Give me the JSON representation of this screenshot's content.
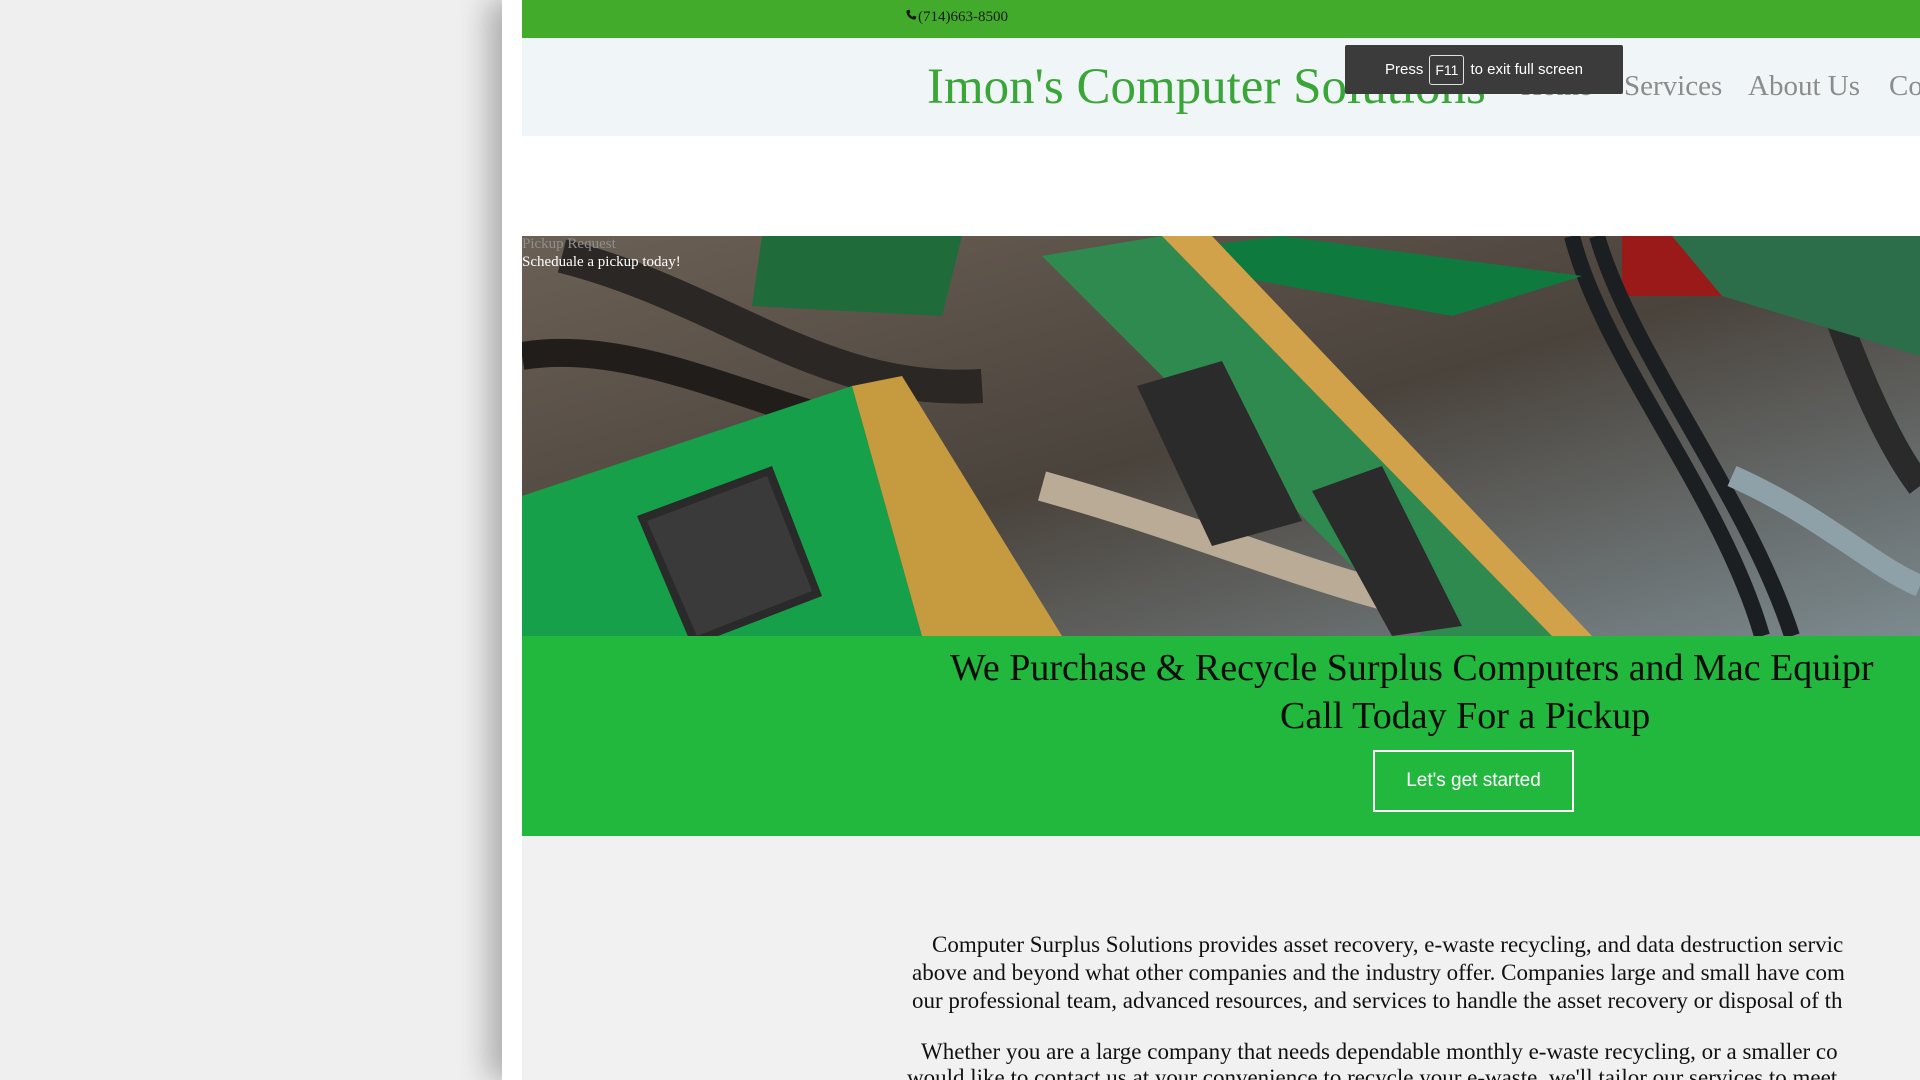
{
  "topbar": {
    "phone_icon": "phone-icon",
    "phone": "(714)663-8500",
    "accent": "#43ab2b"
  },
  "header": {
    "brand": "Imon's Computer Solutions",
    "nav": [
      {
        "label": "Home"
      },
      {
        "label": "Services"
      },
      {
        "label": "About Us"
      },
      {
        "label": "Co"
      }
    ]
  },
  "fullscreen_toast": {
    "press": "Press",
    "key": "F11",
    "rest": "to exit full screen"
  },
  "hero": {
    "kicker": "Pickup Request",
    "subtitle": "Scheduale a pickup today!"
  },
  "cta": {
    "line1": "We Purchase & Recycle Surplus Computers and Mac Equipr",
    "line2": "Call Today For a Pickup",
    "button": "Let's get started",
    "band_color": "#21b83d"
  },
  "content": {
    "paragraph1": [
      "Computer Surplus Solutions provides asset recovery, e-waste recycling, and data destruction servic",
      "above and beyond what other companies and the industry offer. Companies large and small have com",
      "our professional team, advanced resources, and services to handle the asset recovery or disposal of th"
    ],
    "paragraph2": [
      "Whether you are a large company that needs dependable monthly e-waste recycling, or a smaller co",
      "would like to contact us at your convenience to recycle your e-waste, we'll tailor our services to meet"
    ]
  }
}
